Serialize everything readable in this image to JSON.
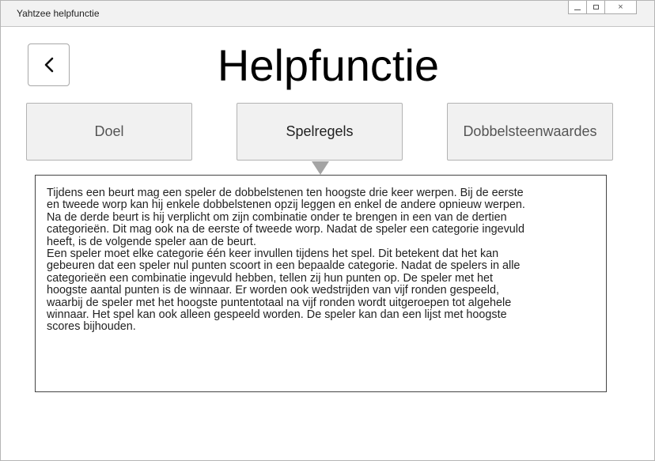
{
  "window": {
    "title": "Yahtzee helpfunctie",
    "controls": {
      "close_label": "×"
    }
  },
  "header": {
    "back_icon": "chevron-left-icon",
    "title": "Helpfunctie"
  },
  "tabs": [
    {
      "label": "Doel",
      "active": false
    },
    {
      "label": "Spelregels",
      "active": true
    },
    {
      "label": "Dobbelsteenwaardes",
      "active": false
    }
  ],
  "content": {
    "paragraph_1": "Tijdens een beurt mag een speler de dobbelstenen ten hoogste drie keer werpen. Bij de eerste\nen tweede worp kan hij enkele dobbelstenen opzij leggen en enkel de andere opnieuw werpen.\nNa de derde beurt is hij verplicht om zijn combinatie onder te brengen in een van de dertien\ncategorieën. Dit mag ook na de eerste of tweede worp. Nadat de speler een categorie ingevuld\nheeft, is de volgende speler aan de beurt.",
    "paragraph_2": "Een speler moet elke categorie één keer invullen tijdens het spel. Dit betekent dat het kan\ngebeuren dat een speler nul punten scoort in een bepaalde categorie. Nadat de spelers in alle\ncategorieën een combinatie ingevuld hebben, tellen zij hun punten op. De speler met het\nhoogste aantal punten is de winnaar. Er worden ook wedstrijden van vijf ronden gespeeld,\nwaarbij de speler met het hoogste puntentotaal na vijf ronden wordt uitgeroepen tot algehele\nwinnaar. Het spel kan ook alleen gespeeld worden. De speler kan dan een lijst met hoogste\nscores bijhouden."
  },
  "colors": {
    "tab_background": "#f1f1f1",
    "tab_border": "#b3b3b3",
    "pointer": "#a4a4a4",
    "content_border": "#444444"
  }
}
